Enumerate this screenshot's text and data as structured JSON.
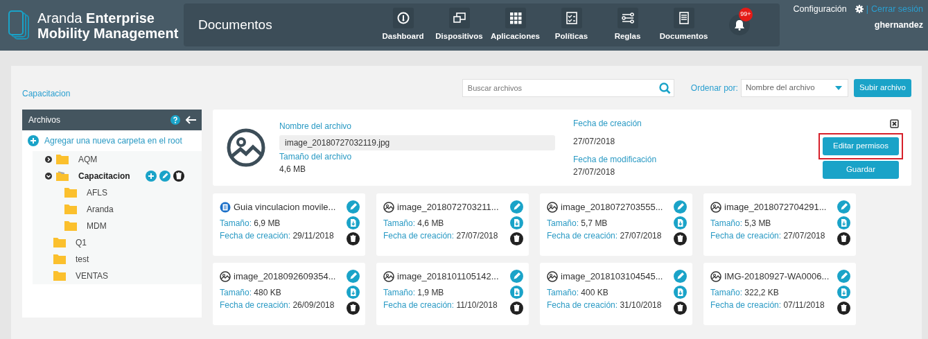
{
  "header": {
    "brand_line1": "Aranda **Enterprise**",
    "brand_line2": "Mobility Management",
    "page_title": "Documentos",
    "nav": [
      {
        "label": "Dashboard",
        "kind": "dashboard"
      },
      {
        "label": "Dispositivos",
        "kind": "devices"
      },
      {
        "label": "Aplicaciones",
        "kind": "apps"
      },
      {
        "label": "Políticas",
        "kind": "policies"
      },
      {
        "label": "Reglas",
        "kind": "rules"
      },
      {
        "label": "Documentos",
        "kind": "documents"
      }
    ],
    "notification_count": "99+",
    "settings_link": "Configuración",
    "separator": "|",
    "logout_link": "Cerrar sesión",
    "username": "ghernandez"
  },
  "toolbar": {
    "breadcrumb": "Capacitacion",
    "search": {
      "placeholder": "Buscar archivos"
    },
    "sort_label": "Ordenar por:",
    "sort_value": "Nombre del archivo",
    "upload_button": "Subir archivo"
  },
  "sidebar": {
    "title": "Archivos",
    "add_root": "Agregar una nueva carpeta en el root",
    "tree": [
      {
        "name": "AQM",
        "expanded": false,
        "selected": false
      },
      {
        "name": "Capacitacion",
        "expanded": true,
        "selected": true,
        "children": [
          {
            "name": "AFLS",
            "selected": false
          },
          {
            "name": "Aranda",
            "selected": false
          },
          {
            "name": "MDM",
            "selected": false
          }
        ]
      },
      {
        "name": "Q1",
        "selected": false
      },
      {
        "name": "test",
        "selected": false
      },
      {
        "name": "VENTAS",
        "selected": false
      }
    ]
  },
  "detail": {
    "name_label": "Nombre del archivo",
    "name_value": "image_20180727032119.jpg",
    "size_label": "Tamaño del archivo",
    "size_value": "4,6 MB",
    "created_label": "Fecha de creación",
    "created_value": "27/07/2018",
    "modified_label": "Fecha de modificación",
    "modified_value": "27/07/2018",
    "buttons": [
      {
        "label": "Editar permisos",
        "highlighted": true
      },
      {
        "label": "Guardar",
        "highlighted": false
      }
    ]
  },
  "files": [
    {
      "kind": "document",
      "name": "Guia vinculacion movile...",
      "size_label": "Tamaño:",
      "size": "6,9 MB",
      "date_label": "Fecha de creación:",
      "date": "29/11/2018"
    },
    {
      "kind": "image",
      "name": "image_2018072703211...",
      "size_label": "Tamaño:",
      "size": "4,6 MB",
      "date_label": "Fecha de creación:",
      "date": "27/07/2018"
    },
    {
      "kind": "image",
      "name": "image_2018072703555...",
      "size_label": "Tamaño:",
      "size": "5,7 MB",
      "date_label": "Fecha de creación:",
      "date": "27/07/2018"
    },
    {
      "kind": "image",
      "name": "image_2018072704291...",
      "size_label": "Tamaño:",
      "size": "5,3 MB",
      "date_label": "Fecha de creación:",
      "date": "27/07/2018"
    },
    {
      "kind": "image",
      "name": "image_2018092609354...",
      "size_label": "Tamaño:",
      "size": "480 KB",
      "date_label": "Fecha de creación:",
      "date": "26/09/2018"
    },
    {
      "kind": "image",
      "name": "image_2018101105142...",
      "size_label": "Tamaño:",
      "size": "1,9 MB",
      "date_label": "Fecha de creación:",
      "date": "11/10/2018"
    },
    {
      "kind": "image",
      "name": "image_2018103104545...",
      "size_label": "Tamaño:",
      "size": "400 KB",
      "date_label": "Fecha de creación:",
      "date": "31/10/2018"
    },
    {
      "kind": "image",
      "name": "IMG-20180927-WA0006...",
      "size_label": "Tamaño:",
      "size": "322,2 KB",
      "date_label": "Fecha de creación:",
      "date": "07/11/2018"
    }
  ]
}
